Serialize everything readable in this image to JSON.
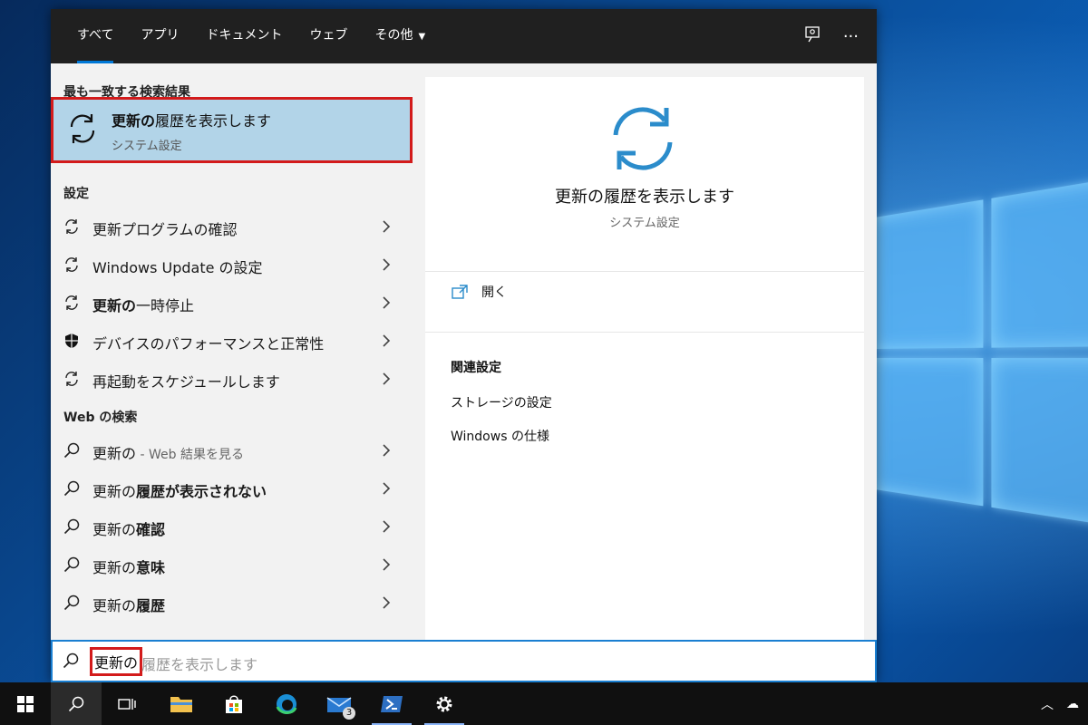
{
  "tabs": {
    "items": [
      "すべて",
      "アプリ",
      "ドキュメント",
      "ウェブ",
      "その他"
    ],
    "active": "すべて"
  },
  "left": {
    "best_match_heading": "最も一致する検索結果",
    "best_match": {
      "title_bold": "更新の",
      "title_rest": "履歴を表示します",
      "subtitle": "システム設定"
    },
    "settings_heading": "設定",
    "settings_items": [
      {
        "pre": "",
        "bold": "",
        "text": "更新プログラムの確認"
      },
      {
        "pre": "",
        "bold": "",
        "text": "Windows Update の設定"
      },
      {
        "pre": "",
        "bold": "更新の",
        "text": "一時停止"
      },
      {
        "pre": "",
        "bold": "",
        "text": "デバイスのパフォーマンスと正常性"
      },
      {
        "pre": "",
        "bold": "",
        "text": "再起動をスケジュールします"
      }
    ],
    "web_heading": "Web の検索",
    "web_items": [
      {
        "normal": "更新の",
        "bold": "",
        "muted": " - Web 結果を見る"
      },
      {
        "normal": "更新の",
        "bold": "履歴が表示されない",
        "muted": ""
      },
      {
        "normal": "更新の",
        "bold": "確認",
        "muted": ""
      },
      {
        "normal": "更新の",
        "bold": "意味",
        "muted": ""
      },
      {
        "normal": "更新の",
        "bold": "履歴",
        "muted": ""
      }
    ]
  },
  "right": {
    "title": "更新の履歴を表示します",
    "subtitle": "システム設定",
    "open_label": "開く",
    "related_heading": "関連設定",
    "related_items": [
      "ストレージの設定",
      "Windows の仕様"
    ]
  },
  "search": {
    "typed": "更新の",
    "hint": "履歴を表示します"
  },
  "taskbar": {
    "mail_badge": "3"
  },
  "colors": {
    "accent": "#0078d7",
    "highlight": "#b2d4e8",
    "annotation": "#d31b1b",
    "refresh_icon": "#2b8ccb"
  }
}
